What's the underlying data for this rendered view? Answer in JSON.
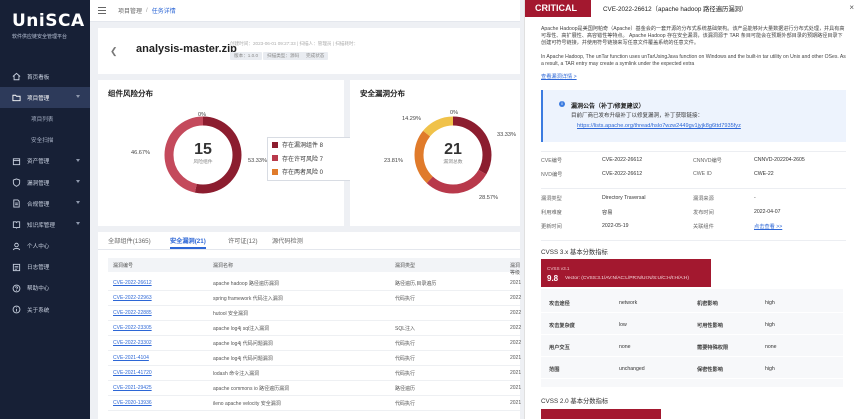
{
  "app": {
    "logo_title": "UniSCA",
    "logo_subtitle": "软件供应链安全管理平台"
  },
  "sidebar": {
    "items": [
      {
        "label": "首页看板",
        "icon": "home-icon"
      },
      {
        "label": "项目管理",
        "icon": "folder-icon",
        "active": true
      },
      {
        "label": "项目列表",
        "sub": true
      },
      {
        "label": "安全扫描",
        "sub": true
      },
      {
        "label": "资产管理",
        "icon": "box-icon"
      },
      {
        "label": "漏洞管理",
        "icon": "shield-icon"
      },
      {
        "label": "合规管理",
        "icon": "doc-icon"
      },
      {
        "label": "知识库管理",
        "icon": "book-icon"
      },
      {
        "label": "个人中心",
        "icon": "user-icon"
      },
      {
        "label": "日志管理",
        "icon": "log-icon"
      },
      {
        "label": "帮助中心",
        "icon": "help-icon"
      },
      {
        "label": "关于系统",
        "icon": "info-icon"
      }
    ]
  },
  "breadcrumb": {
    "parent": "项目管理",
    "separator": "/",
    "current": "任务详情"
  },
  "header": {
    "file_name": "analysis-master.zip",
    "meta": "创建时间：2023-06-01 09:27:33 | 扫描人：管理员 | 扫描耗时：",
    "tags": [
      "版本：1.0.0",
      "扫描类型：源码",
      "完成状态"
    ]
  },
  "risk_card": {
    "title": "组件风险分布",
    "center_value": "15",
    "center_label": "风险组件",
    "pct_left": "46.67%",
    "pct_right": "53.33%",
    "pct_top": "0%",
    "legend": [
      {
        "label": "存在漏洞组件 8",
        "color": "#8c1d2f"
      },
      {
        "label": "存在许可风险 7",
        "color": "#b8394b"
      },
      {
        "label": "存在两者风险 0",
        "color": "#e07b2b"
      }
    ]
  },
  "vuln_card": {
    "title": "安全漏洞分布",
    "center_value": "21",
    "center_label": "漏洞总数",
    "pct_a": "14.29%",
    "pct_b": "33.33%",
    "pct_c": "23.81%",
    "pct_d": "28.57%",
    "pct_e": "0%"
  },
  "tabs": [
    {
      "label": "全部组件(1365)"
    },
    {
      "label": "安全漏洞(21)",
      "active": true
    },
    {
      "label": "许可证(12)"
    },
    {
      "label": "源代码检测"
    }
  ],
  "table": {
    "headers": [
      "漏洞编号",
      "漏洞名称",
      "漏洞类型",
      "漏洞等级"
    ],
    "rows": [
      {
        "id": "CVE-2022-26612",
        "name": "apache hadoop 路径遍历漏洞",
        "type": "路径遍历,目录遍历",
        "level": "2021"
      },
      {
        "id": "CVE-2022-22963",
        "name": "spring framework 代码注入漏洞",
        "type": "代码执行",
        "level": "2022"
      },
      {
        "id": "CVE-2022-22885",
        "name": "hutool 安全漏洞",
        "type": "",
        "level": "2022"
      },
      {
        "id": "CVE-2022-23305",
        "name": "apache log4j sql注入漏洞",
        "type": "SQL注入",
        "level": "2022"
      },
      {
        "id": "CVE-2022-23302",
        "name": "apache log4j 代码问题漏洞",
        "type": "代码执行",
        "level": "2022"
      },
      {
        "id": "CVE-2021-4104",
        "name": "apache log4j 代码问题漏洞",
        "type": "代码执行",
        "level": "2021"
      },
      {
        "id": "CVE-2021-41720",
        "name": "lodash 命令注入漏洞",
        "type": "代码执行",
        "level": "2021"
      },
      {
        "id": "CVE-2021-29425",
        "name": "apache commons io 路径遍历漏洞",
        "type": "路径遍历",
        "level": "2021"
      },
      {
        "id": "CVE-2020-13936",
        "name": "ileno apache velocity 安全漏洞",
        "type": "代码执行",
        "level": "2021"
      }
    ]
  },
  "detail": {
    "severity": "CRITICAL",
    "title": "CVE-2022-26612（apache hadoop 路径遍历漏洞）",
    "close": "×",
    "desc_cn": "Apache Hadoop是美国阿帕奇（Apache）基金会的一套开源的分布式系统基础架构。该产品能够对大量数据进行分布式处理，并具有高可靠性、高扩展性、高容错性等特点。 Apache Hadoop 存在安全漏洞，该漏洞源于 TAR 条目可能会在预期外部目录的预期路径目录下创建可符号链接，并使用符号链接来写任意文件覆盖系统的任意文件。",
    "desc_en": "In Apache Hadoop, The unTar function uses unTarUsingJava function on Windows and the built-in tar utility on Unix and other OSes. As a result, a TAR entry may create a symlink under the expected extra",
    "more": "查看漏洞详情 >",
    "notice_title": "漏洞公告（补丁/修复建议）",
    "notice_desc": "目前厂商已发布升级补丁以修复漏洞，补丁获取链接：",
    "notice_link": "https://lists.apache.org/thread/hslo7wzw2449gv1jyjk8g6ttd7935fyz",
    "info": [
      {
        "k1": "CVE编号",
        "v1": "CVE-2022-26612",
        "k2": "CNNVD编号",
        "v2": "CNNVD-202204-2605"
      },
      {
        "k1": "NVD编号",
        "v1": "CVE-2022-26612",
        "k2": "CWE ID",
        "v2": "CWE-22"
      },
      {
        "k1": "漏洞类型",
        "v1": "Directory Traversal",
        "k2": "漏洞来源",
        "v2": "-"
      },
      {
        "k1": "利用难度",
        "v1": "容易",
        "k2": "发布时间",
        "v2": "2022-04-07"
      },
      {
        "k1": "更新时间",
        "v1": "2022-05-19",
        "k2": "关联组件",
        "v2": "点击查看 >>"
      }
    ],
    "cvss3_title": "CVSS 3.x 基本分数指标",
    "cvss3_version": "CVSS v3.1",
    "cvss3_score": "9.8",
    "cvss3_vector": "Vector: (CVSS:3.1/AV:N/AC:L/PR:N/UI:N/S:U/C:H/I:H/A:H)",
    "metrics": [
      {
        "k1": "攻击途径",
        "v1": "network",
        "k2": "机密影响",
        "v2": "high"
      },
      {
        "k1": "攻击复杂度",
        "v1": "low",
        "k2": "可用性影响",
        "v2": "high"
      },
      {
        "k1": "用户交互",
        "v1": "none",
        "k2": "需要特殊权限",
        "v2": "none"
      },
      {
        "k1": "范围",
        "v1": "unchanged",
        "k2": "保密性影响",
        "v2": "high"
      }
    ],
    "cvss2_title": "CVSS 2.0 基本分数指标"
  }
}
